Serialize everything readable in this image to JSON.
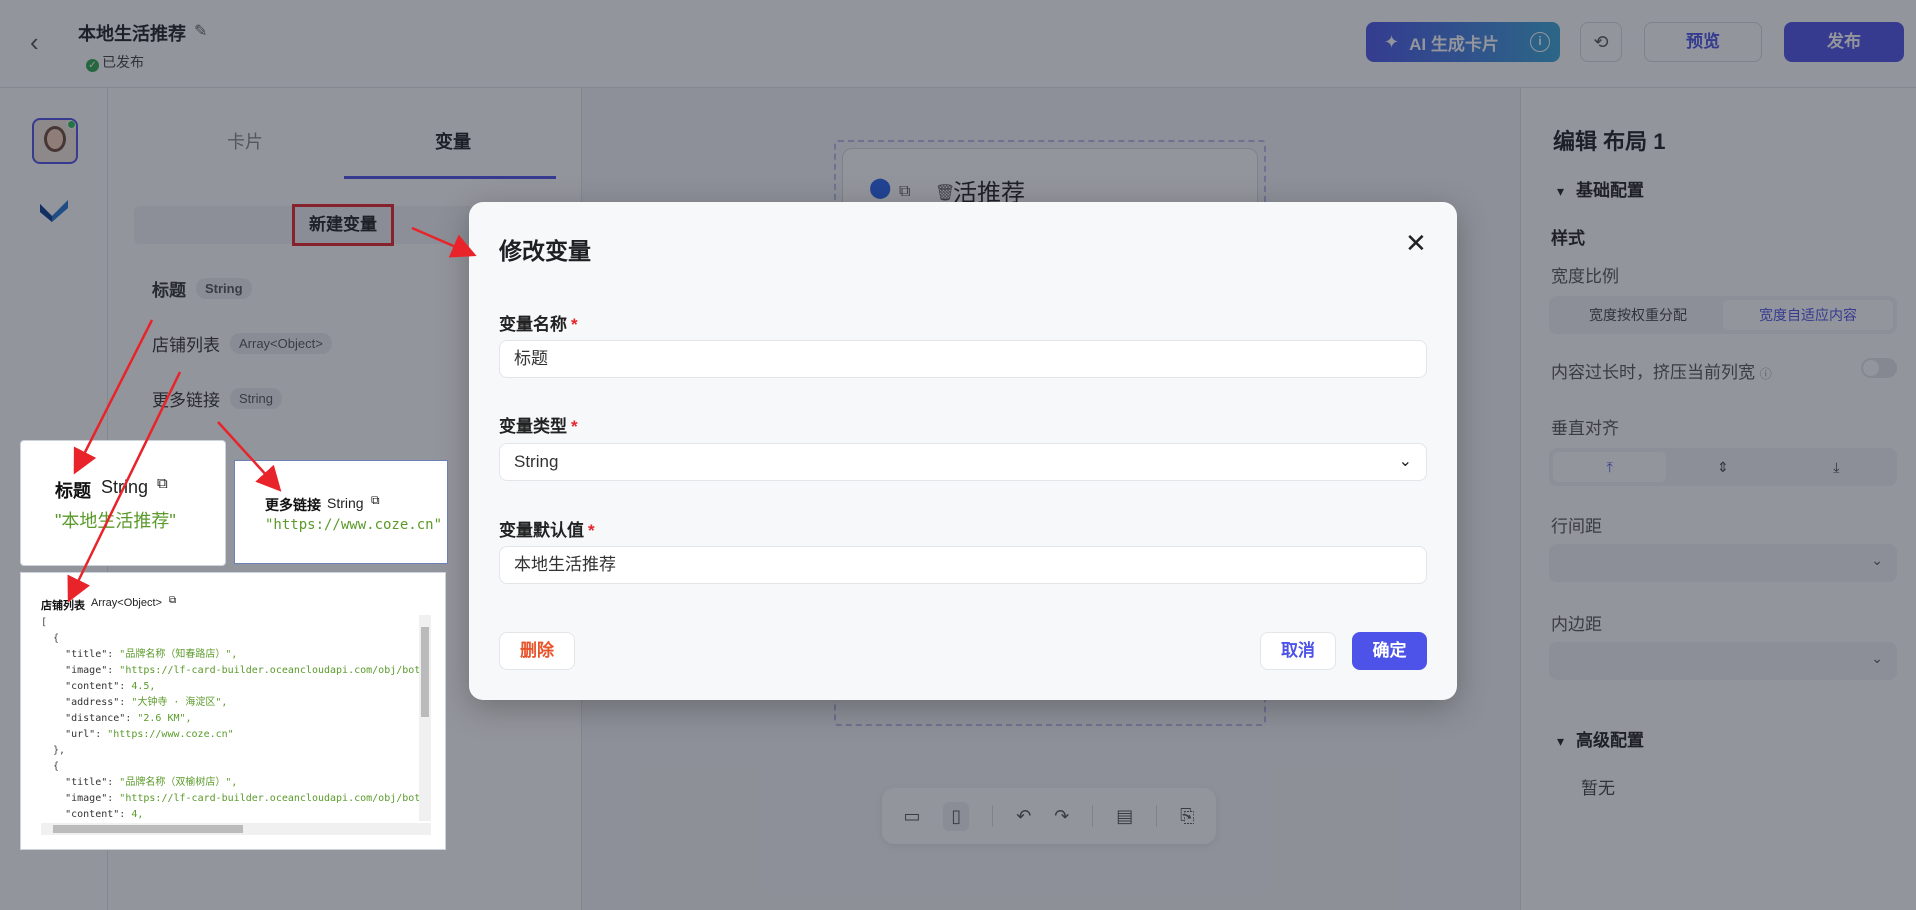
{
  "header": {
    "title": "本地生活推荐",
    "status": "已发布",
    "ai_button": "AI 生成卡片",
    "preview": "预览",
    "publish": "发布"
  },
  "left_panel": {
    "tabs": [
      {
        "label": "卡片"
      },
      {
        "label": "变量"
      }
    ],
    "new_variable": "新建变量",
    "variables": [
      {
        "name": "标题",
        "type": "String"
      },
      {
        "name": "店铺列表",
        "type": "Array<Object>"
      },
      {
        "name": "更多链接",
        "type": "String"
      }
    ]
  },
  "canvas": {
    "card_text": "活推荐"
  },
  "right_panel": {
    "title": "编辑 布局 1",
    "basic_config": "基础配置",
    "style_label": "样式",
    "width_ratio": "宽度比例",
    "width_options": [
      "宽度按权重分配",
      "宽度自适应内容"
    ],
    "overflow_label": "内容过长时，挤压当前列宽",
    "vertical_align": "垂直对齐",
    "line_spacing": "行间距",
    "padding": "内边距",
    "advanced_config": "高级配置",
    "advanced_none": "暂无"
  },
  "modal": {
    "title": "修改变量",
    "name_label": "变量名称",
    "name_value": "标题",
    "type_label": "变量类型",
    "type_value": "String",
    "default_label": "变量默认值",
    "default_value": "本地生活推荐",
    "delete": "删除",
    "cancel": "取消",
    "confirm": "确定"
  },
  "callouts": {
    "title": {
      "name": "标题",
      "type": "String",
      "value": "\"本地生活推荐\""
    },
    "more": {
      "name": "更多链接",
      "type": "String",
      "value": "\"https://www.coze.cn\""
    },
    "shops": {
      "name": "店铺列表",
      "type": "Array<Object>",
      "code_lines": [
        "[",
        "  {",
        "    \"title\": \"品牌名称（知春路店）\",",
        "    \"image\": \"https://lf-card-builder.oceancloudapi.com/obj/bot-",
        "    \"content\": 4.5,",
        "    \"address\": \"大钟寺 · 海淀区\",",
        "    \"distance\": \"2.6 KM\",",
        "    \"url\": \"https://www.coze.cn\"",
        "  },",
        "  {",
        "    \"title\": \"品牌名称（双榆树店）\",",
        "    \"image\": \"https://lf-card-builder.oceancloudapi.com/obj/bot-",
        "    \"content\": 4,"
      ]
    }
  },
  "colors": {
    "accent": "#4d53e8",
    "danger": "#e8232a",
    "string_green": "#5a9a2a"
  }
}
